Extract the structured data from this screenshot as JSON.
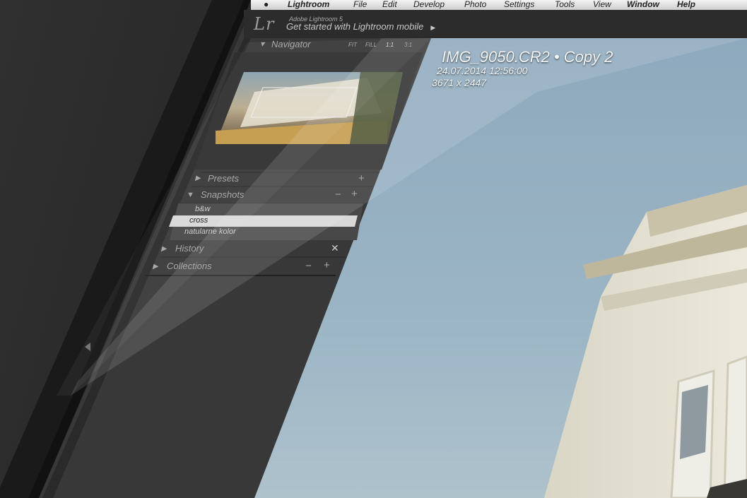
{
  "menubar": {
    "app": "Lightroom",
    "items": [
      "File",
      "Edit",
      "Develop",
      "Photo",
      "Settings",
      "Tools",
      "View",
      "Window",
      "Help"
    ]
  },
  "header": {
    "logo": "Lr",
    "subtitle": "Adobe Lightroom 5",
    "mobile_link": "Get started with Lightroom mobile"
  },
  "navigator": {
    "title": "Navigator",
    "zoom_options": [
      "FIT",
      "FILL",
      "1:1",
      "3:1"
    ]
  },
  "panels": {
    "presets": "Presets",
    "snapshots": "Snapshots",
    "history": "History",
    "collections": "Collections"
  },
  "snapshots": {
    "items": [
      "b&w",
      "cross",
      "natularne kolor"
    ],
    "selected": "cross"
  },
  "photo": {
    "name": "IMG_9050.CR2  •  Copy 2",
    "date": "24.07.2014 12:56:00",
    "dimensions": "3671 x 2447"
  },
  "colors": {
    "sky": "#9bb3c4",
    "panel": "#3a3a3a",
    "selected_row": "#d9d9d9"
  }
}
